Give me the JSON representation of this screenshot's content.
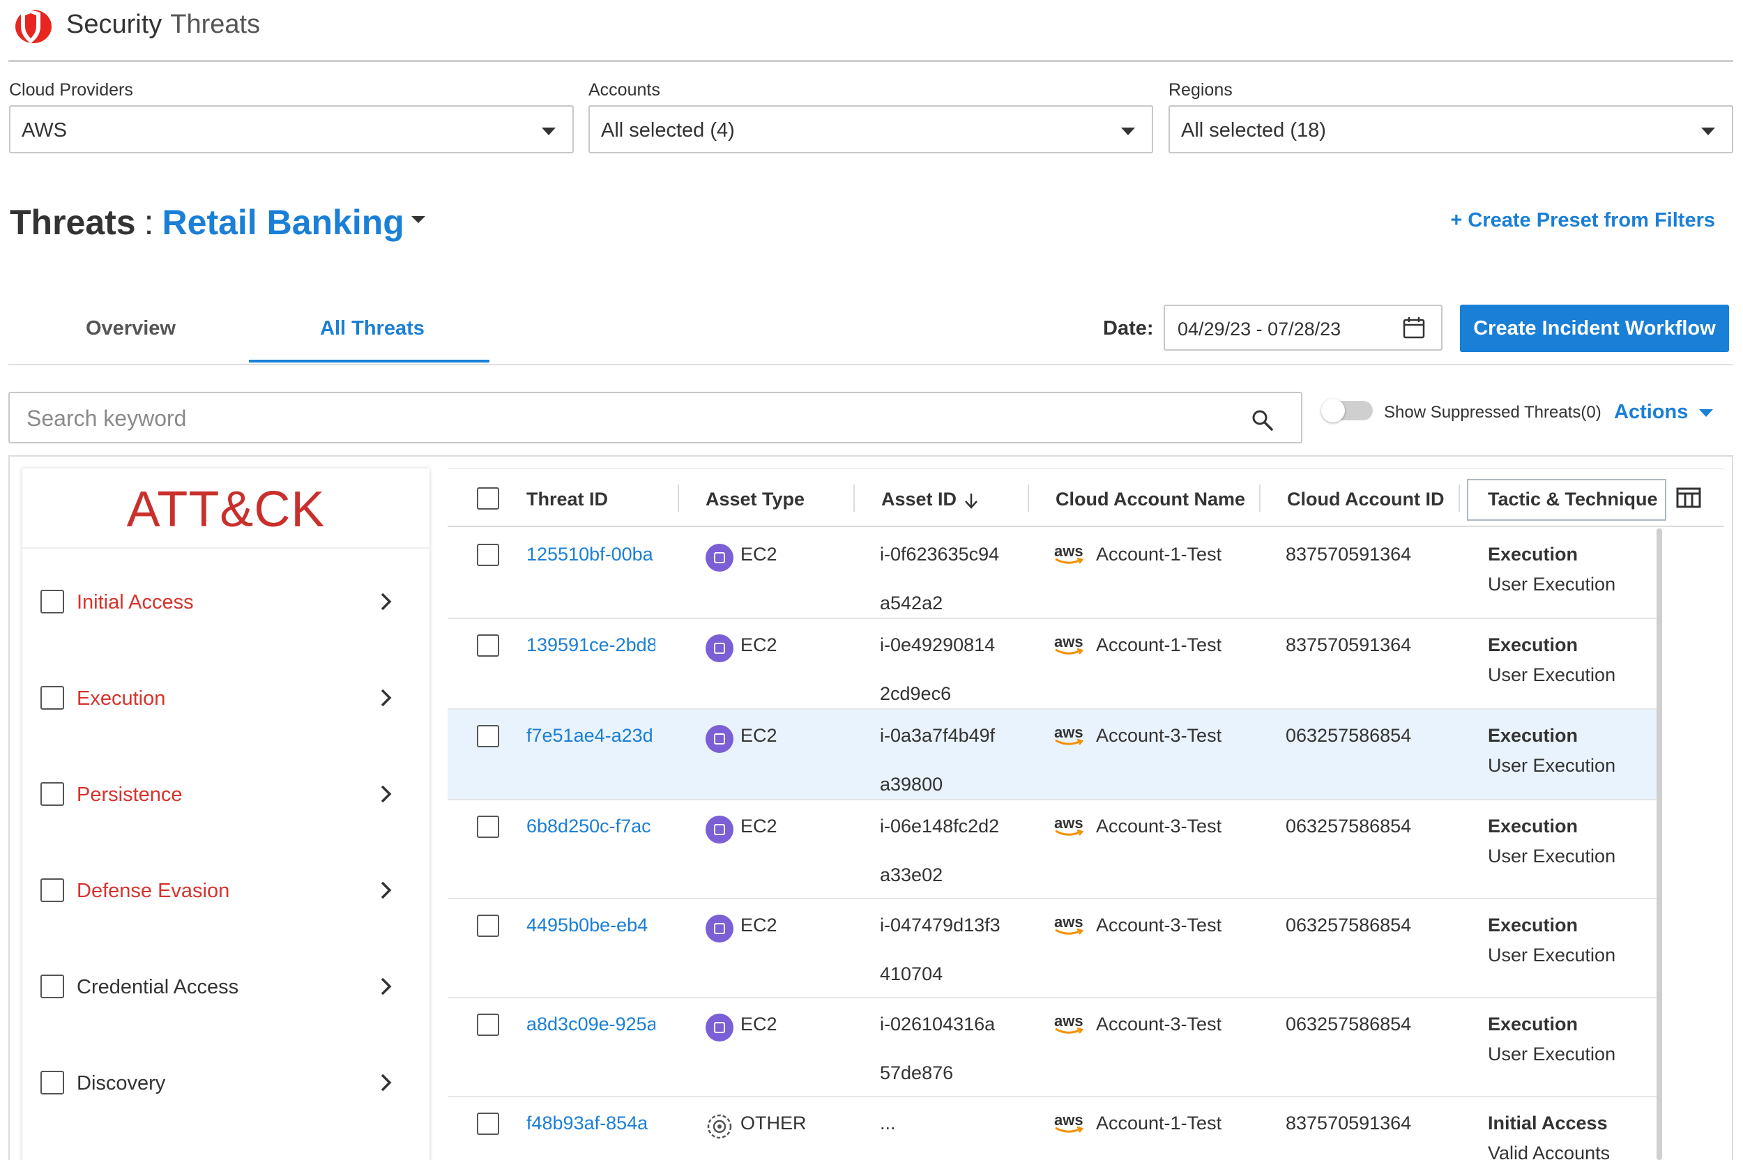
{
  "app": {
    "brand": "Security",
    "section": "Threats"
  },
  "filters": [
    {
      "label": "Cloud Providers",
      "value": "AWS"
    },
    {
      "label": "Accounts",
      "value": "All selected (4)"
    },
    {
      "label": "Regions",
      "value": "All selected (18)"
    }
  ],
  "page": {
    "title": "Threats",
    "separator": ":",
    "preset": "Retail Banking",
    "create_preset": "+ Create Preset from Filters"
  },
  "tabs": [
    {
      "label": "Overview"
    },
    {
      "label": "All Threats"
    }
  ],
  "date": {
    "label": "Date:",
    "value": "04/29/23 - 07/28/23"
  },
  "create_workflow": "Create Incident Workflow",
  "search": {
    "placeholder": "Search keyword"
  },
  "suppressed_label": "Show Suppressed Threats(0)",
  "actions_label": "Actions",
  "attack": {
    "title": "ATT&CK",
    "tactics": [
      {
        "label": "Initial Access"
      },
      {
        "label": "Execution"
      },
      {
        "label": "Persistence"
      },
      {
        "label": "Defense Evasion"
      },
      {
        "label": "Credential Access"
      },
      {
        "label": "Discovery"
      }
    ]
  },
  "table": {
    "columns": [
      "Threat ID",
      "Asset Type",
      "Asset ID",
      "Cloud Account Name",
      "Cloud Account ID",
      "Tactic & Technique"
    ],
    "rows": [
      {
        "threat_id": "125510bf-00ba",
        "asset_type": "EC2",
        "asset_id_1": "i-0f623635c94",
        "asset_id_2": "a542a2",
        "account_name": "Account-1-Test",
        "account_id": "837570591364",
        "tactic": "Execution",
        "technique": "User Execution"
      },
      {
        "threat_id": "139591ce-2bd8",
        "asset_type": "EC2",
        "asset_id_1": "i-0e49290814",
        "asset_id_2": "2cd9ec6",
        "account_name": "Account-1-Test",
        "account_id": "837570591364",
        "tactic": "Execution",
        "technique": "User Execution"
      },
      {
        "threat_id": "f7e51ae4-a23d",
        "asset_type": "EC2",
        "asset_id_1": "i-0a3a7f4b49f",
        "asset_id_2": "a39800",
        "account_name": "Account-3-Test",
        "account_id": "063257586854",
        "tactic": "Execution",
        "technique": "User Execution"
      },
      {
        "threat_id": "6b8d250c-f7ac",
        "asset_type": "EC2",
        "asset_id_1": "i-06e148fc2d2",
        "asset_id_2": "a33e02",
        "account_name": "Account-3-Test",
        "account_id": "063257586854",
        "tactic": "Execution",
        "technique": "User Execution"
      },
      {
        "threat_id": "4495b0be-eb4",
        "asset_type": "EC2",
        "asset_id_1": "i-047479d13f3",
        "asset_id_2": "410704",
        "account_name": "Account-3-Test",
        "account_id": "063257586854",
        "tactic": "Execution",
        "technique": "User Execution"
      },
      {
        "threat_id": "a8d3c09e-925a",
        "asset_type": "EC2",
        "asset_id_1": "i-026104316a",
        "asset_id_2": "57de876",
        "account_name": "Account-3-Test",
        "account_id": "063257586854",
        "tactic": "Execution",
        "technique": "User Execution"
      },
      {
        "threat_id": "f48b93af-854a",
        "asset_type": "OTHER",
        "asset_id_1": "...",
        "asset_id_2": "",
        "account_name": "Account-1-Test",
        "account_id": "837570591364",
        "tactic": "Initial Access",
        "technique": "Valid Accounts"
      }
    ],
    "aws_mark": "aws"
  },
  "colors": {
    "accent": "#1a7fd6",
    "attack_red": "#c9302c",
    "tactic_red": "#d6332d",
    "ec2_purple": "#7b5fd6",
    "highlight_row": "#e9f3fd"
  },
  "icons": {
    "logo": "shield-logo-icon",
    "calendar": "calendar-icon",
    "search": "search-icon",
    "chevron": "chevron-right-icon",
    "columns": "columns-icon",
    "ec2": "ec2-icon",
    "other": "other-asset-icon"
  }
}
